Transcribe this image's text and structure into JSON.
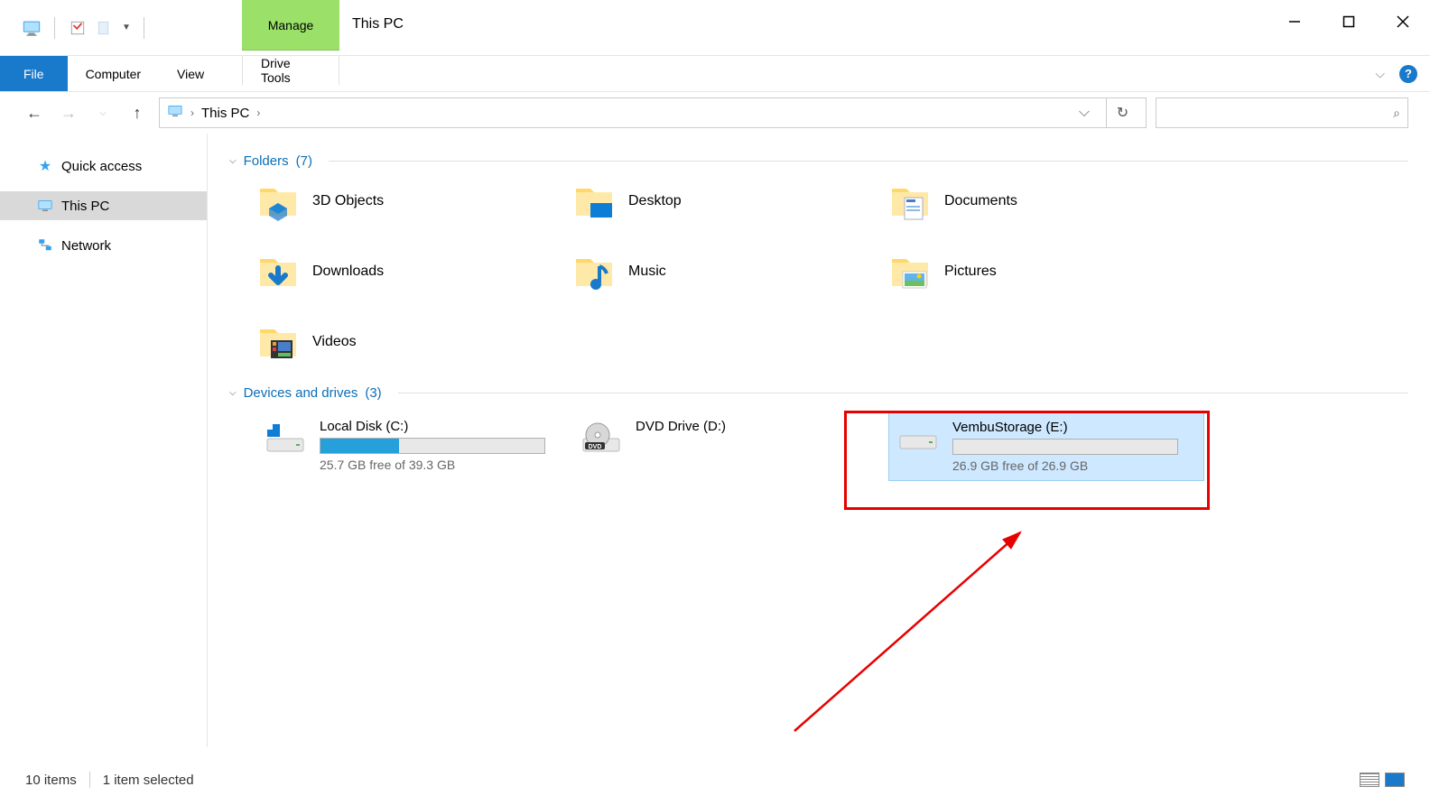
{
  "window": {
    "title": "This PC",
    "tab_manage": "Manage"
  },
  "ribbon": {
    "file": "File",
    "computer": "Computer",
    "view": "View",
    "drive_tools": "Drive Tools"
  },
  "nav": {
    "path": "This PC"
  },
  "sidebar": {
    "quick_access": "Quick access",
    "this_pc": "This PC",
    "network": "Network"
  },
  "sections": {
    "folders": {
      "label": "Folders",
      "count": "(7)"
    },
    "drives": {
      "label": "Devices and drives",
      "count": "(3)"
    }
  },
  "folders": [
    {
      "label": "3D Objects"
    },
    {
      "label": "Desktop"
    },
    {
      "label": "Documents"
    },
    {
      "label": "Downloads"
    },
    {
      "label": "Music"
    },
    {
      "label": "Pictures"
    },
    {
      "label": "Videos"
    }
  ],
  "drives": [
    {
      "label": "Local Disk (C:)",
      "free": "25.7 GB free of 39.3 GB",
      "fill_pct": 35,
      "type": "hdd"
    },
    {
      "label": "DVD Drive (D:)",
      "free": "",
      "fill_pct": 0,
      "type": "dvd"
    },
    {
      "label": "VembuStorage (E:)",
      "free": "26.9 GB free of 26.9 GB",
      "fill_pct": 0,
      "type": "hdd",
      "selected": true
    }
  ],
  "status": {
    "items": "10 items",
    "selected": "1 item selected"
  }
}
